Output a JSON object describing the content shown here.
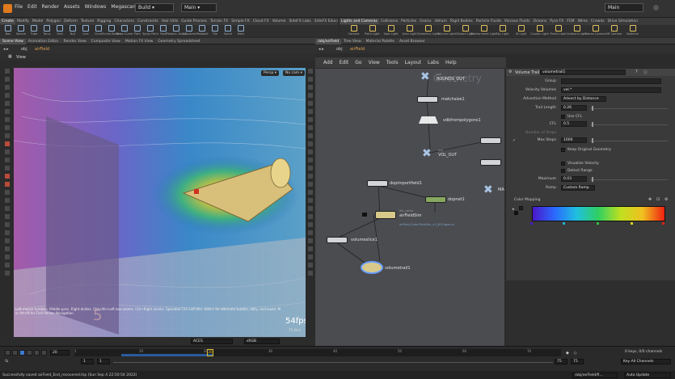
{
  "menubar": {
    "items": [
      "File",
      "Edit",
      "Render",
      "Assets",
      "Windows",
      "Megascans",
      "Labs",
      "Help"
    ],
    "build_label": "Build",
    "main_label": "Main",
    "right_main_label": "Main"
  },
  "shelf_left": {
    "tabs": [
      "Create",
      "Modify",
      "Model",
      "Polygon",
      "Deform",
      "Texture",
      "Rigging",
      "Characters",
      "Constraints",
      "Hair Utils",
      "Guide Process",
      "Terrain FX",
      "Simple FX",
      "Cloud FX",
      "Volume",
      "SideFX Labs",
      "SideFX Education"
    ],
    "tools": [
      "Box",
      "Sphere",
      "Tube",
      "Torus",
      "Grid",
      "Null",
      "Line",
      "Circle",
      "Curve Bezier",
      "Draw Curve",
      "Path",
      "Spray Paint",
      "Font",
      "Platonic Solids",
      "L-System",
      "Metaball",
      "File",
      "Spiral",
      "Helix"
    ]
  },
  "shelf_right": {
    "tabs": [
      "Lights and Cameras",
      "Collisions",
      "Particles",
      "Grains",
      "Vellum",
      "Rigid Bodies",
      "Particle Fluids",
      "Viscous Fluids",
      "Oceans",
      "Pyro FX",
      "FEM",
      "Wires",
      "Crowds",
      "Drive Simulation"
    ],
    "tools": [
      "Camera",
      "Point Light",
      "Spot Light",
      "Area Light",
      "Geometry Light",
      "Volume Light",
      "Distant Light",
      "Environment Light",
      "Sky Light",
      "GI Light",
      "Caustic Light",
      "Portal Light",
      "Ambient Light",
      "Stereo Camera",
      "VR Camera",
      "Switcher"
    ]
  },
  "left_pane": {
    "tabs": [
      "Scene View",
      "Animation Editor",
      "Render View",
      "Composite View",
      "Motion FX View",
      "Geometry Spreadsheet"
    ],
    "path": [
      "obj",
      "airField"
    ],
    "viewport_title": "View",
    "persp_label": "Persp",
    "cam_label": "No cam",
    "fps_label": "54fps",
    "time_label": "71.4ms",
    "hint_text": "Left mouse tumbles. Middle pans. Right dollies. Ctrl+Alt+Left box-zooms. Ctrl+Right zooms. Spacebar-Ctrl-Left tilts. Hold L for alternate tumble, dolly, and zoom. M or Alt+M for First Person Navigation."
  },
  "network": {
    "tabs": [
      "/obj/airField",
      "Tree View",
      "Material Palette",
      "Asset Browser"
    ],
    "path": [
      "obj",
      "airField"
    ],
    "menu": [
      "Add",
      "Edit",
      "Go",
      "View",
      "Tools",
      "Layout",
      "Labs",
      "Help"
    ],
    "watermark": "Geometry",
    "nodes": [
      {
        "label": "BOUNDS_OUT",
        "sub": "null"
      },
      {
        "label": "matchsize1",
        "sub": ""
      },
      {
        "label": "vdbfrompolygons1",
        "sub": ""
      },
      {
        "label": "VOL_OUT",
        "sub": "null"
      },
      {
        "label": "dopimportfield1",
        "sub": ""
      },
      {
        "label": "dopnet1",
        "sub": ""
      },
      {
        "label": "airFieldSim",
        "sub": "file_cache"
      },
      {
        "label": "airField_EndurFieldSim_v1_$F4.bgeo.sc",
        "sub": ""
      },
      {
        "label": "volumeslice1",
        "sub": ""
      },
      {
        "label": "volumetrail1",
        "sub": ""
      },
      {
        "label": "MA",
        "sub": ""
      }
    ]
  },
  "params": {
    "node_type": "Volume Trail",
    "node_name": "volumetrail1",
    "rows": [
      {
        "label": "Group",
        "value": ""
      },
      {
        "label": "Velocity Volumes",
        "value": "vel.*"
      },
      {
        "label": "Advection Method",
        "value": "Advect by Distance"
      },
      {
        "label": "Trail Length",
        "value": "0.26"
      },
      {
        "label": "Use CFL",
        "value": ""
      },
      {
        "label": "CFL",
        "value": "0.5"
      },
      {
        "label": "Number of Steps",
        "value": ""
      },
      {
        "label": "Max Steps",
        "value": "1000"
      },
      {
        "label": "Keep Original Geometry",
        "value": ""
      },
      {
        "label": "Visualize Velocity",
        "value": ""
      },
      {
        "label": "Detect Range",
        "value": ""
      },
      {
        "label": "Maximum",
        "value": "0.03"
      },
      {
        "label": "Ramp",
        "value": "Custom Ramp"
      },
      {
        "label": "Color Mapping",
        "value": ""
      }
    ]
  },
  "timeline": {
    "frame": "20",
    "start": "1",
    "start2": "1",
    "end": "75",
    "end2": "75",
    "ticks": [
      "1",
      "10",
      "20",
      "30",
      "40",
      "50",
      "60",
      "70"
    ],
    "keys_info": "0 keys, 0/0 channels",
    "key_all": "Key All Channels",
    "auto_update": "Auto Update",
    "path_short": "/obj/airField/fi...",
    "acces_label": "ACES",
    "srgb_label": "sRGB",
    "status": "Successfully saved airField_End_recovered.hip (Sun Sep 4 22:50:54 2022)"
  },
  "colors": {
    "accent_orange": "#e07a1f",
    "node_yellow": "#d8c98a",
    "node_green": "#88a860",
    "node_blue": "#7fa3c9"
  }
}
